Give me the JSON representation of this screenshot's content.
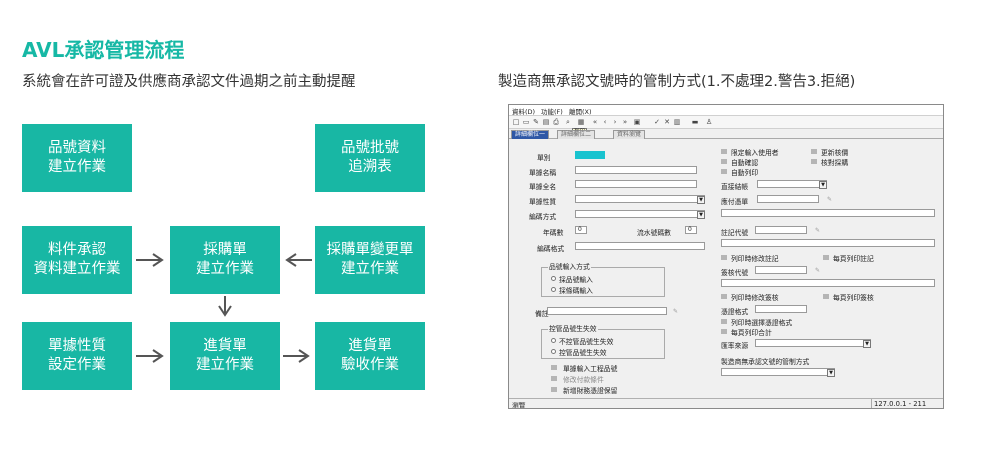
{
  "title": "AVL承認管理流程",
  "subtitle": "系統會在許可證及供應商承認文件過期之前主動提醒",
  "method_title": "製造商無承認文號時的管制方式(1.不處理2.警告3.拒絕)",
  "flow_boxes": {
    "b1": "品號資料\n建立作業",
    "b2": "品號批號\n追溯表",
    "b3": "料件承認\n資料建立作業",
    "b4": "採購單\n建立作業",
    "b5": "採購單變更單\n建立作業",
    "b6": "單據性質\n設定作業",
    "b7": "進貨單\n建立作業",
    "b8": "進貨單\n驗收作業"
  },
  "screenshot": {
    "menu": [
      "資料(D)",
      "功能(F)",
      "離開(X)"
    ],
    "tooltip": "列印",
    "tabs": [
      "詳細欄位一",
      "詳細欄位二",
      "資料瀏覽"
    ],
    "left": {
      "doc_type": "單別",
      "doc_name": "單據名稱",
      "doc_full": "單據全名",
      "doc_nature": "單據性質",
      "code_method": "編碼方式",
      "year_code": "年碼數",
      "year_val": "0",
      "serial_code": "流水號碼數",
      "serial_val": "0",
      "code_format": "編碼格式",
      "input_group": "品號輸入方式",
      "input_opt1": "採品號輸入",
      "input_opt2": "採條碼輸入",
      "remark": "備註",
      "ctrl_group": "控管品號生失效",
      "ctrl_opt1": "不控管品號生失效",
      "ctrl_opt2": "控管品號生失效",
      "chk1": "單據輸入工程品號",
      "chk2": "修改付款條件",
      "chk3": "新增財務憑證保留"
    },
    "right": {
      "c1": "限定輸入使用者",
      "c2": "更新核價",
      "c3": "自動確認",
      "c4": "核對採購",
      "c5": "自動列印",
      "direct": "直接結帳",
      "attach": "應付憑單",
      "note_code": "註記代號",
      "c6": "列印時修改註記",
      "c7": "每頁列印註記",
      "sign_code": "簽核代號",
      "c8": "列印時修改簽核",
      "c9": "每頁列印簽核",
      "report_format": "憑證格式",
      "c10": "列印時選擇憑證格式",
      "c11": "每頁列印合計",
      "rate_source": "匯率來源",
      "mfr_ctrl": "製造商無承認文號的管制方式"
    },
    "status": {
      "left": "瀏覽",
      "right": "127.0.0.1 - 211"
    }
  }
}
